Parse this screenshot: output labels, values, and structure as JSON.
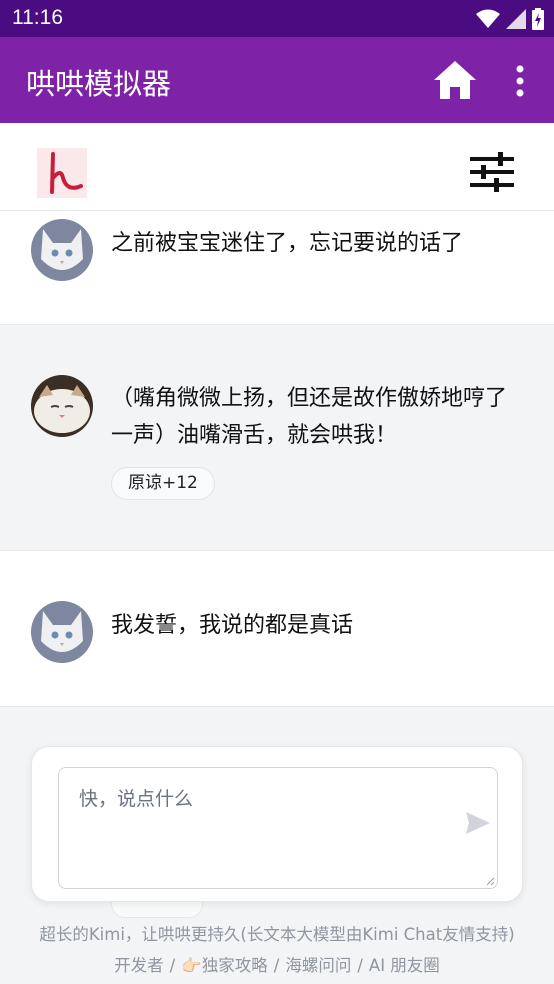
{
  "status_bar": {
    "time": "11:16",
    "icons": [
      "wifi-icon",
      "cell-signal-icon",
      "battery-charging-icon"
    ]
  },
  "app_bar": {
    "title": "哄哄模拟器",
    "icons": [
      "home-icon",
      "more-vert-icon"
    ]
  },
  "toolbar": {
    "icons": [
      "logo-icon",
      "sliders-icon"
    ]
  },
  "messages": [
    {
      "text": "之前被宝宝迷住了，忘记要说的话了"
    },
    {
      "text": "（嘴角微微上扬，但还是故作傲娇地哼了一声）油嘴滑舌，就会哄我！",
      "badge": "原谅+12"
    },
    {
      "text": "我发誓，我说的都是真话"
    }
  ],
  "input": {
    "placeholder": "快，说点什么"
  },
  "footer": {
    "line1": "超长的Kimi，让哄哄更持久(长文本大模型由Kimi Chat友情支持)",
    "links": [
      "开发者",
      "👉🏻独家攻略",
      "海螺问问",
      "AI 朋友圈"
    ],
    "separator": "/"
  },
  "colors": {
    "status_bar": "#4a0c80",
    "app_bar": "#7e22a8",
    "background": "#f3f4f6"
  }
}
